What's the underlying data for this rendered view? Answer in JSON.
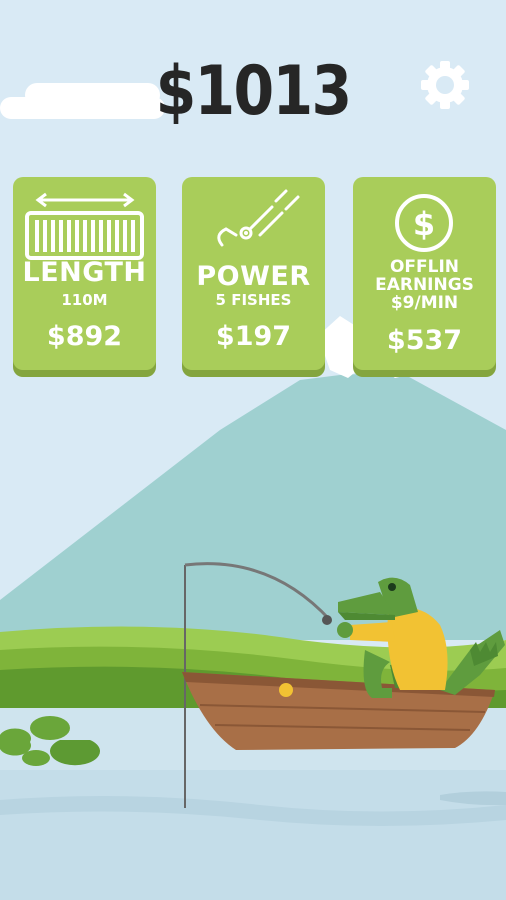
{
  "hud": {
    "money": "$1013",
    "settings_icon": "gear-icon"
  },
  "upgrades": {
    "length": {
      "title": "LENGTH",
      "detail": "110M",
      "price": "$892",
      "icon": "rope-length-icon"
    },
    "power": {
      "title": "POWER",
      "detail": "5 FISHES",
      "price": "$197",
      "icon": "fishing-hook-icon"
    },
    "offline": {
      "title_line1": "OFFLIN",
      "title_line2": "EARNINGS",
      "detail": "$9/MIN",
      "price": "$537",
      "icon": "dollar-coin-icon"
    }
  },
  "colors": {
    "sky": "#d9eaf5",
    "card": "#a9cd5a",
    "card_shadow": "#84a53e",
    "mountain": "#9fd0d0",
    "grass": "#7fb43a",
    "boat": "#a86f47",
    "crocodile": "#5f9c3e",
    "shirt": "#f2c233"
  }
}
